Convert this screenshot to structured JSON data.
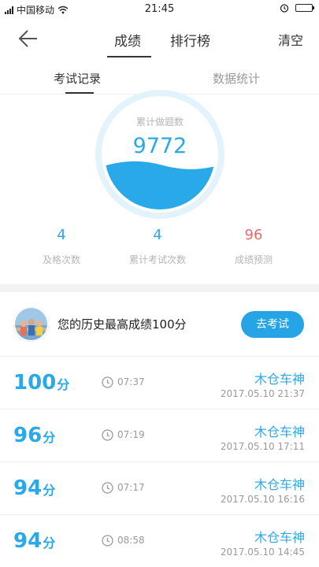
{
  "status_bar": {
    "carrier": "中国移动",
    "time": "21:45"
  },
  "nav": {
    "tabs": [
      {
        "label": "成绩",
        "active": true
      },
      {
        "label": "排行榜",
        "active": false
      }
    ],
    "clear_label": "清空"
  },
  "sub_tabs": [
    {
      "label": "考试记录",
      "active": true
    },
    {
      "label": "数据统计",
      "active": false
    }
  ],
  "summary": {
    "gauge_label": "累计做题数",
    "total_questions": "9772",
    "stats": [
      {
        "value": "4",
        "label": "及格次数",
        "color": "#2aa9ea"
      },
      {
        "value": "4",
        "label": "累计考试次数",
        "color": "#2aa9ea"
      },
      {
        "value": "96",
        "label": "成绩预测",
        "color": "#e86a6a"
      }
    ]
  },
  "best": {
    "text": "您的历史最高成绩100分",
    "button_label": "去考试"
  },
  "records": [
    {
      "score": "100",
      "unit": "分",
      "duration": "07:37",
      "user": "木仓车神",
      "date": "2017.05.10  21:37"
    },
    {
      "score": "96",
      "unit": "分",
      "duration": "07:19",
      "user": "木仓车神",
      "date": "2017.05.10  17:11"
    },
    {
      "score": "94",
      "unit": "分",
      "duration": "07:17",
      "user": "木仓车神",
      "date": "2017.05.10  16:16"
    },
    {
      "score": "94",
      "unit": "分",
      "duration": "08:58",
      "user": "木仓车神",
      "date": "2017.05.10  14:45"
    }
  ],
  "colors": {
    "accent": "#2aa9ea",
    "button": "#27a4e6",
    "prediction": "#e86a6a"
  }
}
